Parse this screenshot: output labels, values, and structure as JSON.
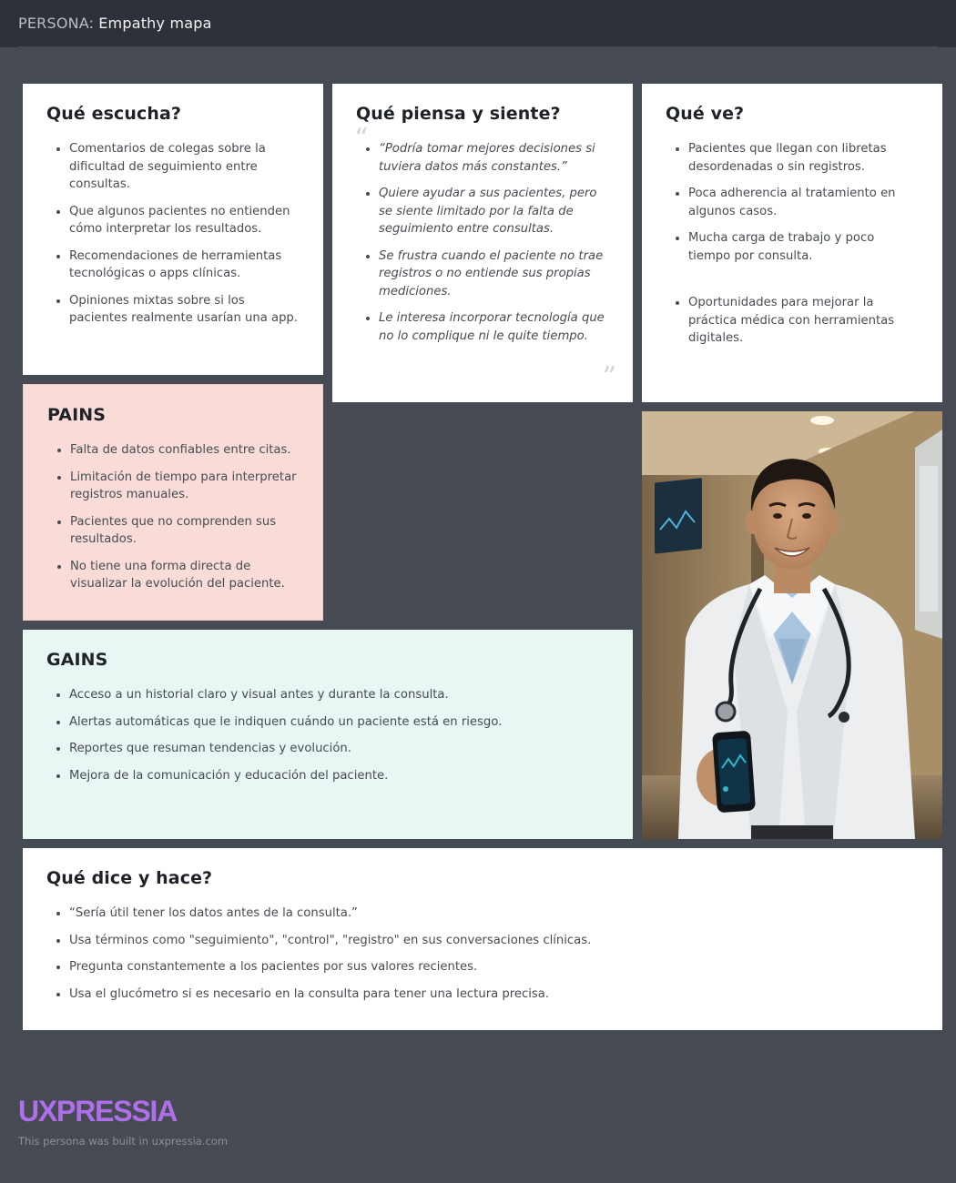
{
  "header": {
    "prefix": "PERSONA:",
    "title": "Empathy mapa"
  },
  "escucha": {
    "title": "Qué escucha?",
    "items": [
      "Comentarios de colegas sobre la dificultad de seguimiento entre consultas.",
      "Que algunos pacientes no entienden cómo interpretar los resultados.",
      "Recomendaciones de herramientas tecnológicas o apps clínicas.",
      "Opiniones mixtas sobre si los pacientes realmente usarían una app."
    ]
  },
  "piensa": {
    "title": "Qué piensa y siente?",
    "items": [
      "“Podría tomar mejores decisiones si tuviera datos más constantes.”",
      "Quiere ayudar a sus pacientes, pero se siente limitado por la falta de seguimiento entre consultas.",
      "Se frustra cuando el paciente no trae registros o no entiende sus propias mediciones.",
      "Le interesa incorporar tecnología que no lo complique ni le quite tiempo."
    ]
  },
  "ve": {
    "title": "Qué ve?",
    "items": [
      "Pacientes que llegan con libretas desordenadas o sin registros.",
      "Poca adherencia al tratamiento en algunos casos.",
      "Mucha carga de trabajo y poco tiempo por consulta.",
      "Oportunidades para mejorar la práctica médica con herramientas digitales."
    ]
  },
  "pains": {
    "title": "PAINS",
    "items": [
      "Falta de datos confiables entre citas.",
      "Limitación de tiempo para interpretar registros manuales.",
      "Pacientes que no comprenden sus resultados.",
      "No tiene una forma directa de visualizar la evolución del paciente."
    ]
  },
  "gains": {
    "title": "GAINS",
    "items": [
      "Acceso a un historial claro y visual antes y durante la consulta.",
      "Alertas automáticas que le indiquen cuándo un paciente está en riesgo.",
      "Reportes que resuman tendencias y evolución.",
      "Mejora de la comunicación y educación del paciente."
    ]
  },
  "dice": {
    "title": "Qué dice y hace?",
    "items": [
      "“Sería útil tener los datos antes de la consulta.”",
      "Usa términos como \"seguimiento\", \"control\", \"registro\" en sus conversaciones clínicas.",
      "Pregunta constantemente a los pacientes por sus valores recientes.",
      "Usa el glucómetro si es necesario en la consulta para tener una lectura precisa."
    ]
  },
  "photo": {
    "alt": "persona-photo-doctor"
  },
  "footer": {
    "brand": "UXPRESSIA",
    "note": "This persona was built in uxpressia.com"
  },
  "colors": {
    "background": "#454a53",
    "topbar": "#2e3138",
    "pains_bg": "#f9dcd8",
    "gains_bg": "#e8f7f4",
    "brand": "#b06fea"
  }
}
